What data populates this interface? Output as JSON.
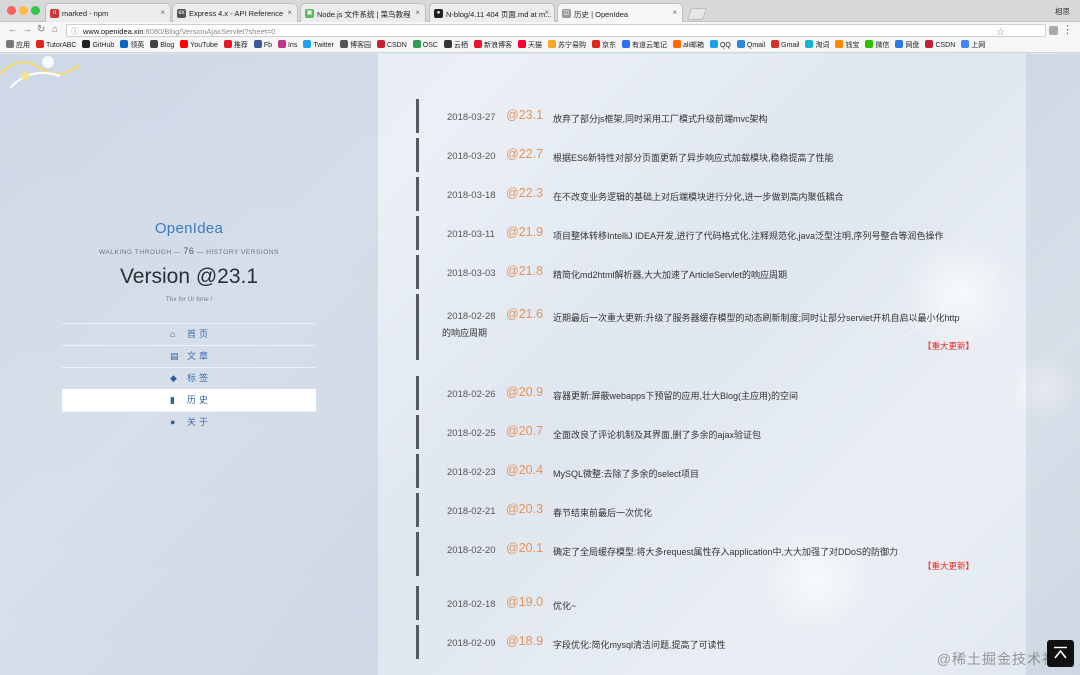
{
  "browser": {
    "tabs": [
      {
        "title": "marked - npm",
        "fav_color": "#cb3837",
        "fav_glyph": "n",
        "active": false
      },
      {
        "title": "Express 4.x - API Reference",
        "fav_color": "#555555",
        "fav_glyph": "ex",
        "active": false
      },
      {
        "title": "Node.js 文件系统 | 菜鸟教程",
        "fav_color": "#5fb760",
        "fav_glyph": "▣",
        "active": false
      },
      {
        "title": "N-blog/4.11 404 页面.md at m...",
        "fav_color": "#222222",
        "fav_glyph": "●",
        "active": false
      },
      {
        "title": "历史 | OpenIdea",
        "fav_color": "#999999",
        "fav_glyph": "◫",
        "active": true
      }
    ],
    "profile": "相思",
    "url_host": "www.openidea.xin",
    "url_rest": ":8080/Blog/VersionAjaxServlet?sheet=0",
    "bookmarks": [
      {
        "label": "应用",
        "color": "#777777"
      },
      {
        "label": "TutorABC",
        "color": "#e2231a"
      },
      {
        "label": "GitHub",
        "color": "#222222"
      },
      {
        "label": "领英",
        "color": "#0a66c2"
      },
      {
        "label": "Blog",
        "color": "#444444"
      },
      {
        "label": "YouTube",
        "color": "#ff0000"
      },
      {
        "label": "推荐",
        "color": "#e6162d"
      },
      {
        "label": "Fb",
        "color": "#3b5998"
      },
      {
        "label": "Ins",
        "color": "#c13584"
      },
      {
        "label": "Twitter",
        "color": "#1da1f2"
      },
      {
        "label": "博客园",
        "color": "#555555"
      },
      {
        "label": "CSDN",
        "color": "#c32136"
      },
      {
        "label": "OSC",
        "color": "#2e9f4e"
      },
      {
        "label": "云栖",
        "color": "#333333"
      },
      {
        "label": "新浪博客",
        "color": "#e6162d"
      },
      {
        "label": "天猫",
        "color": "#ff0036"
      },
      {
        "label": "苏宁易购",
        "color": "#f5a623"
      },
      {
        "label": "京东",
        "color": "#e1251b"
      },
      {
        "label": "有道云笔记",
        "color": "#2f6ff5"
      },
      {
        "label": "ali邮箱",
        "color": "#ff6a00"
      },
      {
        "label": "QQ",
        "color": "#1aa0e6"
      },
      {
        "label": "Qmail",
        "color": "#2e86de"
      },
      {
        "label": "Gmail",
        "color": "#d93025"
      },
      {
        "label": "淘词",
        "color": "#19b2d6"
      },
      {
        "label": "钱宝",
        "color": "#ff8800"
      },
      {
        "label": "微信",
        "color": "#2dc100"
      },
      {
        "label": "网盘",
        "color": "#2c7be5"
      },
      {
        "label": "CSDN",
        "color": "#c32136"
      },
      {
        "label": "上网",
        "color": "#4285f4"
      }
    ]
  },
  "sidebar": {
    "site_name": "OpenIdea",
    "tagline_pre": "WALKING THROUGH —",
    "tagline_count": "76",
    "tagline_post": "— HISTORY VERSIONS",
    "version": "Version @23.1",
    "thanks": "Thx for Ur time !",
    "nav": [
      {
        "label": "首页",
        "icon": "home-icon",
        "glyph": "⌂",
        "active": false
      },
      {
        "label": "文章",
        "icon": "film-icon",
        "glyph": "▤",
        "active": false
      },
      {
        "label": "标签",
        "icon": "tags-icon",
        "glyph": "◆",
        "active": false
      },
      {
        "label": "历史",
        "icon": "book-icon",
        "glyph": "▮",
        "active": true
      },
      {
        "label": "关于",
        "icon": "user-icon",
        "glyph": "●",
        "active": false
      }
    ]
  },
  "timeline": [
    {
      "date": "2018-03-27",
      "version": "@23.1",
      "desc": "放弃了部分js框架,同时采用工厂模式升级前端mvc架构"
    },
    {
      "date": "2018-03-20",
      "version": "@22.7",
      "desc": "根据ES6新特性对部分页面更新了异步响应式加载模块,稳稳提高了性能"
    },
    {
      "date": "2018-03-18",
      "version": "@22.3",
      "desc": "在不改变业务逻辑的基础上对后端模块进行分化,进一步做到高内聚低耦合"
    },
    {
      "date": "2018-03-11",
      "version": "@21.9",
      "desc": "项目整体转移IntelliJ IDEA开发,进行了代码格式化,注释规范化,java泛型注明,序列号整合等润色操作"
    },
    {
      "date": "2018-03-03",
      "version": "@21.8",
      "desc": "精简化md2html解析器,大大加速了ArticleServlet的响应周期"
    },
    {
      "date": "2018-02-28",
      "version": "@21.6",
      "desc": "近期最后一次重大更新:升级了服务器缓存模型的动态刷新制度;同时让部分serviet开机自启以最小化http",
      "desc_cont": "的响应周期",
      "major": "【重大更新】"
    },
    {
      "date": "2018-02-26",
      "version": "@20.9",
      "desc": "容器更新:屏蔽webapps下预留的应用,壮大Blog(主应用)的空间"
    },
    {
      "date": "2018-02-25",
      "version": "@20.7",
      "desc": "全面改良了评论机制及其界面,删了多余的ajax验证包"
    },
    {
      "date": "2018-02-23",
      "version": "@20.4",
      "desc": "MySQL微整:去除了多余的select项目"
    },
    {
      "date": "2018-02-21",
      "version": "@20.3",
      "desc": "春节结束前最后一次优化"
    },
    {
      "date": "2018-02-20",
      "version": "@20.1",
      "desc": "确定了全局缓存模型:将大多request属性存入application中,大大加强了对DDoS的防御力",
      "major": "【重大更新】"
    },
    {
      "date": "2018-02-18",
      "version": "@19.0",
      "desc": "优化~"
    },
    {
      "date": "2018-02-09",
      "version": "@18.9",
      "desc": "字段优化:简化mysql清洁问题,提高了可读性"
    }
  ],
  "watermark": "@稀土掘金技术社区"
}
